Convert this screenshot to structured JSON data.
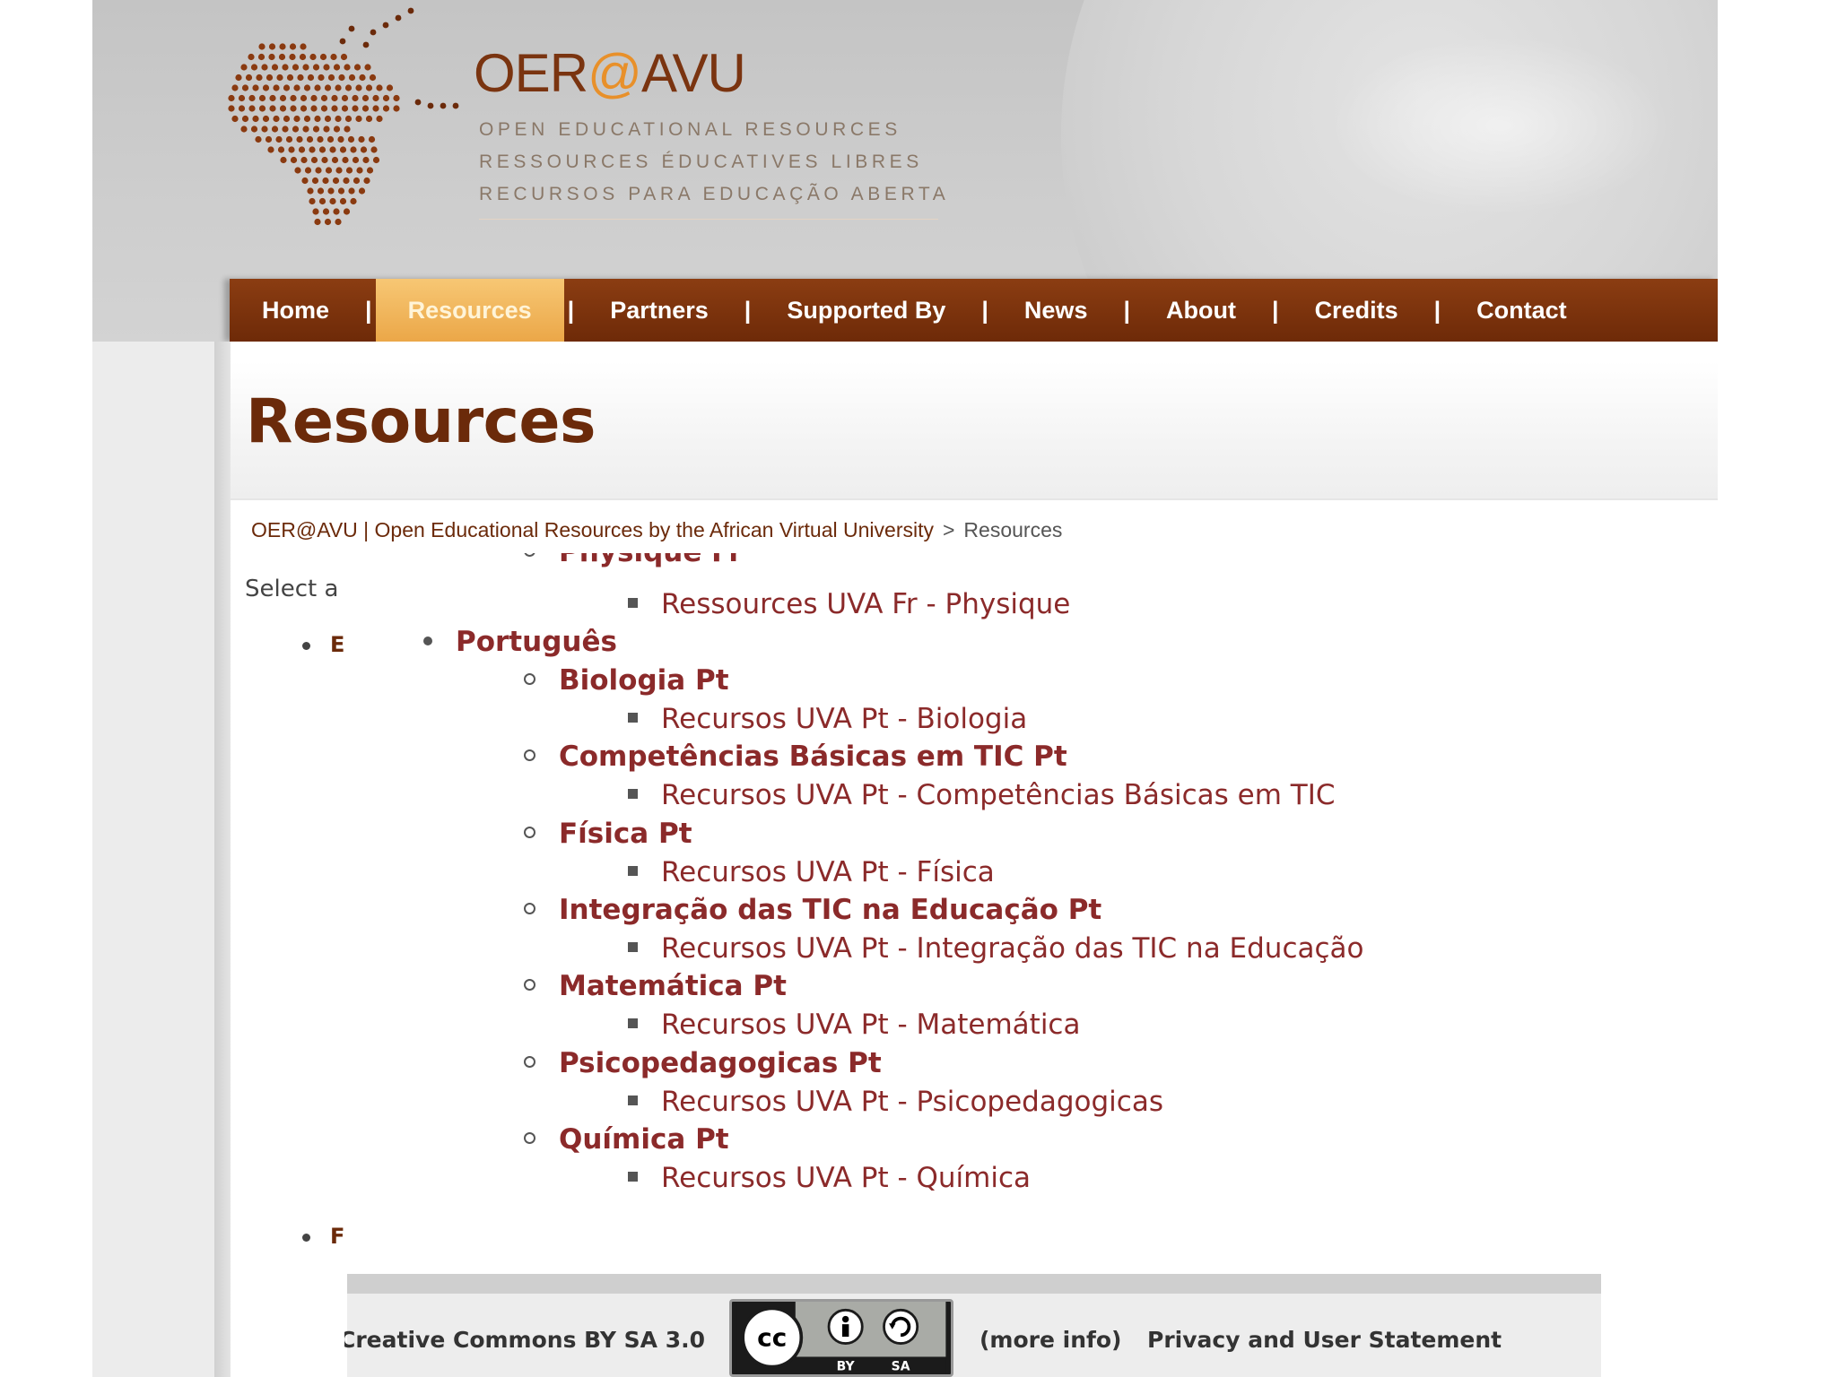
{
  "header": {
    "logo_title_pre": "OER",
    "logo_title_at": "@",
    "logo_title_post": "AVU",
    "taglines": [
      "OPEN EDUCATIONAL RESOURCES",
      "RESSOURCES ÉDUCATIVES LIBRES",
      "RECURSOS PARA EDUCAÇÃO ABERTA"
    ]
  },
  "nav": {
    "items": [
      "Home",
      "Resources",
      "Partners",
      "Supported By",
      "News",
      "About",
      "Credits",
      "Contact"
    ],
    "active": "Resources",
    "separator": "|"
  },
  "page": {
    "title": "Resources",
    "breadcrumb": {
      "root": "OER@AVU | Open Educational Resources by the African Virtual University",
      "separator": ">",
      "current": "Resources"
    },
    "select_prefix": "Select a",
    "left_bullets": [
      "E",
      "F"
    ]
  },
  "tree": {
    "clipped_item": "Physique Fr",
    "clipped_child": "Ressources UVA Fr - Physique",
    "language": "Português",
    "subjects": [
      {
        "name": "Biologia Pt",
        "resource": "Recursos UVA Pt - Biologia"
      },
      {
        "name": "Competências Básicas em TIC Pt",
        "resource": "Recursos UVA Pt - Competências Básicas em TIC"
      },
      {
        "name": "Física Pt",
        "resource": "Recursos UVA Pt - Física"
      },
      {
        "name": "Integração das TIC na Educação Pt",
        "resource": "Recursos UVA Pt - Integração das TIC na Educação"
      },
      {
        "name": "Matemática Pt",
        "resource": "Recursos UVA Pt - Matemática"
      },
      {
        "name": "Psicopedagogicas Pt",
        "resource": "Recursos UVA Pt - Psicopedagogicas"
      },
      {
        "name": "Química Pt",
        "resource": "Recursos UVA Pt - Química"
      }
    ]
  },
  "footer": {
    "license": "Creative Commons BY SA 3.0",
    "cc_badge": {
      "cc": "cc",
      "by": "BY",
      "sa": "SA"
    },
    "more_info": "(more info)",
    "privacy": "Privacy and User Statement"
  },
  "colors": {
    "brand_brown": "#6b2a0a",
    "nav_active": "#eba748",
    "link": "#8b2a2a"
  }
}
